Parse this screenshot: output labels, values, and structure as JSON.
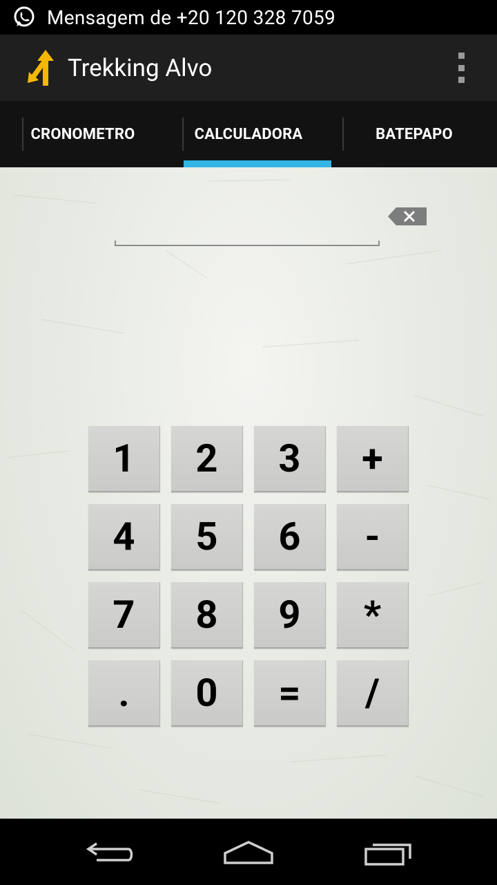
{
  "status_bar": {
    "notification_icon": "whatsapp-icon",
    "text": "Mensagem de +20 120 328 7059"
  },
  "action_bar": {
    "logo_icon": "trekking-arrow-icon",
    "title": "Trekking Alvo",
    "overflow_icon": "overflow-menu-icon"
  },
  "tabs": [
    {
      "label": "CRONOMETRO",
      "selected": false
    },
    {
      "label": "CALCULADORA",
      "selected": true
    },
    {
      "label": "BATEPAPO",
      "selected": false
    }
  ],
  "calculator": {
    "display_value": "",
    "backspace_icon": "backspace-icon",
    "keys": [
      [
        "1",
        "2",
        "3",
        "+"
      ],
      [
        "4",
        "5",
        "6",
        "-"
      ],
      [
        "7",
        "8",
        "9",
        "*"
      ],
      [
        ".",
        "0",
        "=",
        "/"
      ]
    ]
  },
  "nav_bar": {
    "back_icon": "back-icon",
    "home_icon": "home-icon",
    "recents_icon": "recent-apps-icon"
  },
  "colors": {
    "tab_indicator": "#33b5e5",
    "action_bar": "#1f1f1f",
    "logo_yellow": "#f5b800"
  }
}
